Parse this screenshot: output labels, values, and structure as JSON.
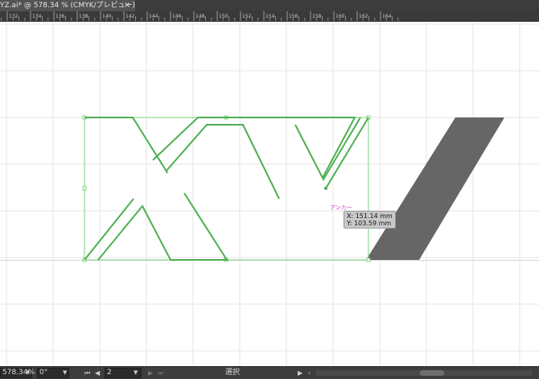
{
  "tab": {
    "title": "YZ.ai* @ 578.34 % (CMYK/プレビュー)",
    "close_glyph": "×"
  },
  "ruler": {
    "labels": [
      "130",
      "132",
      "134",
      "136",
      "138",
      "140",
      "142",
      "144",
      "146",
      "148",
      "150",
      "152",
      "154",
      "156",
      "158",
      "160",
      "162",
      "164"
    ],
    "units": "mm"
  },
  "canvas": {
    "anchor_label": "アンカー",
    "tooltip": {
      "x_line": "X: 151.14 mm",
      "y_line": "Y: 103.59 mm"
    },
    "colors": {
      "selection": "#4caf50",
      "filled_shape": "#666666",
      "guide": "#7ed07e",
      "grid": "#e6e6e6"
    }
  },
  "statusbar": {
    "zoom": "578.34%",
    "rotation": "0°",
    "artboard_number": "2",
    "tool_name": "選択",
    "icons": {
      "first": "first-artboard-icon",
      "prev": "previous-artboard-icon",
      "next": "next-artboard-icon",
      "last": "last-artboard-icon",
      "play": "play-icon",
      "scroll_left": "scroll-left-icon"
    }
  }
}
